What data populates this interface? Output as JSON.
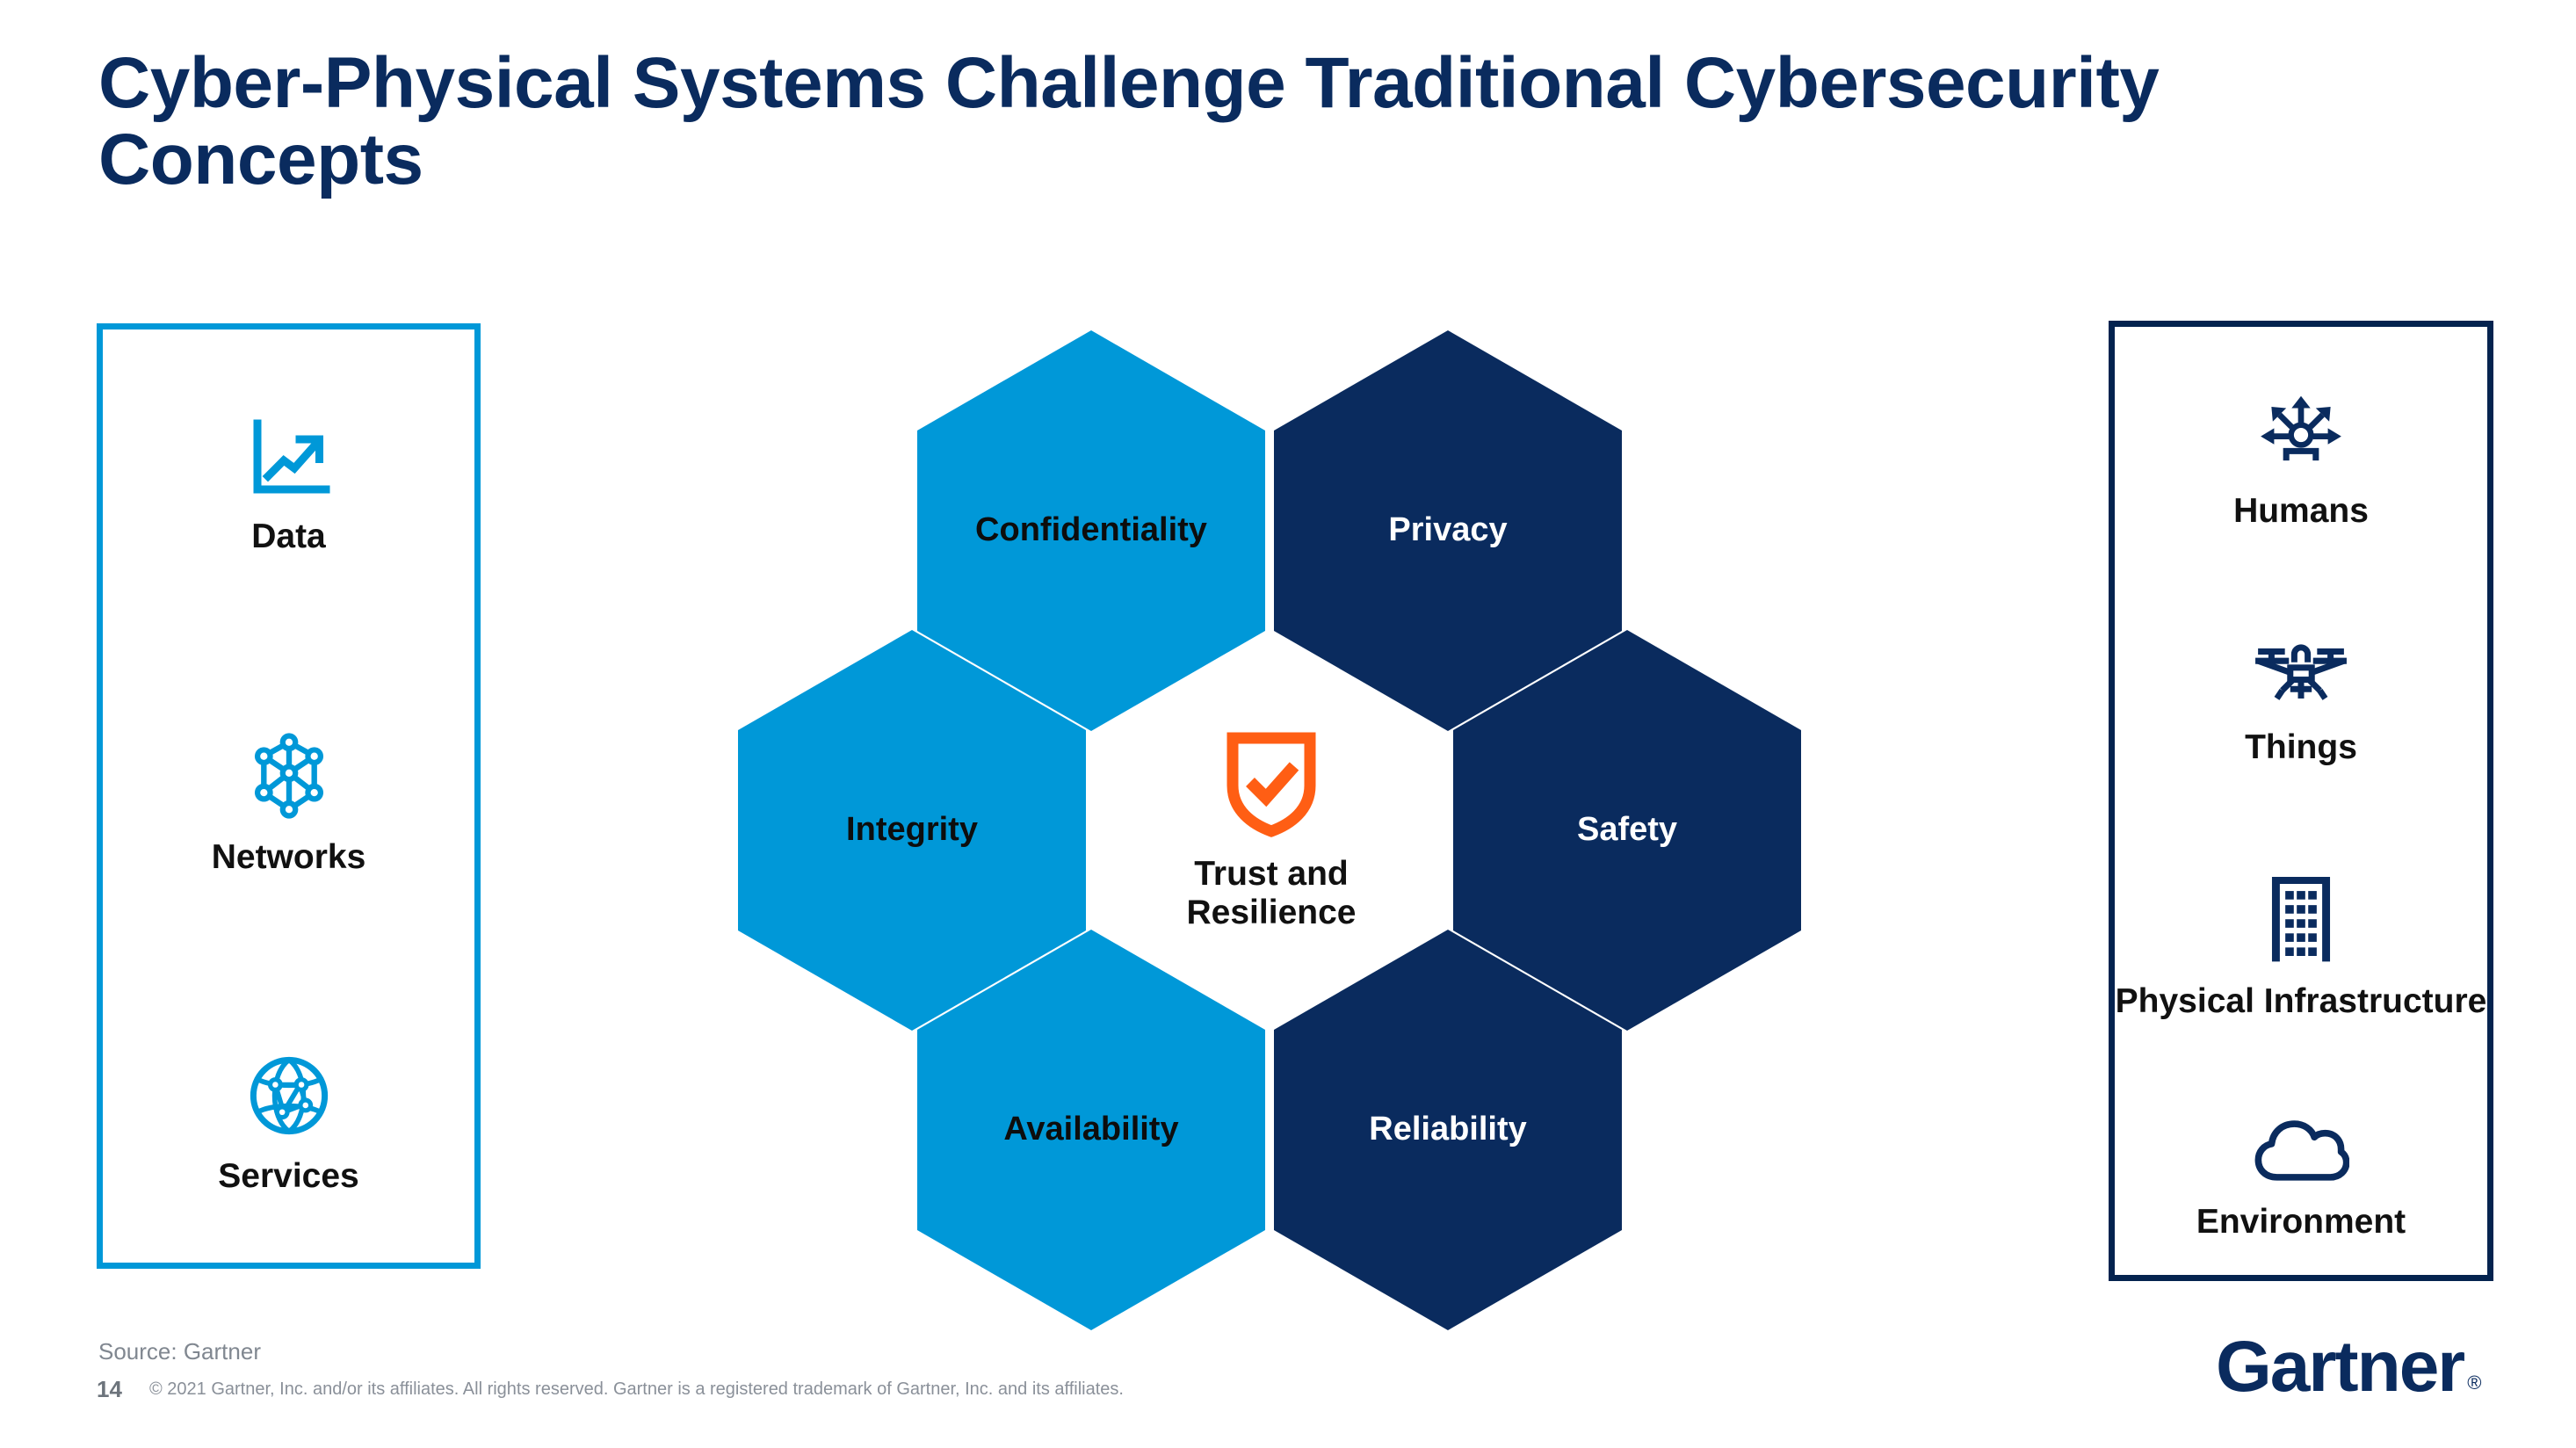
{
  "slide": {
    "title": "Cyber-Physical Systems Challenge Traditional Cybersecurity Concepts",
    "page_number": "14",
    "source_note": "Source: Gartner",
    "copyright_note": "© 2021 Gartner, Inc. and/or its affiliates. All rights reserved. Gartner is a registered trademark of Gartner, Inc. and its affiliates.",
    "logo": {
      "wordmark": "Gartner",
      "registered_mark": "®"
    }
  },
  "colors": {
    "title_navy": "#0A2B5E",
    "light_blue": "#0098D8",
    "dark_navy": "#0A2B5E",
    "panel_border_left": "#0098D8",
    "panel_border_right": "#04234F",
    "shield_orange": "#FF5E14",
    "label_black": "#111111",
    "footer_gray": "#808790"
  },
  "left_panel": {
    "border_color": "#0098D8",
    "items": [
      {
        "label": "Data",
        "icon": "line-chart-growth-icon"
      },
      {
        "label": "Networks",
        "icon": "network-nodes-icon"
      },
      {
        "label": "Services",
        "icon": "global-network-sphere-icon"
      }
    ]
  },
  "right_panel": {
    "border_color": "#04234F",
    "items": [
      {
        "label": "Humans",
        "icon": "person-radiating-arrows-icon"
      },
      {
        "label": "Things",
        "icon": "drone-icon"
      },
      {
        "label": "Physical Infrastructure",
        "icon": "building-icon"
      },
      {
        "label": "Environment",
        "icon": "cloud-icon"
      }
    ]
  },
  "hex_cluster": {
    "center": {
      "label": "Trust and\nResilience",
      "icon": "shield-check-icon",
      "icon_color": "#FF5E14"
    },
    "hexagons": [
      {
        "key": "confidentiality",
        "label": "Confidentiality",
        "fill": "#0098D8",
        "text_color": "#0d0d0d",
        "position": "top-left"
      },
      {
        "key": "privacy",
        "label": "Privacy",
        "fill": "#0A2B5E",
        "text_color": "#ffffff",
        "position": "top-right"
      },
      {
        "key": "integrity",
        "label": "Integrity",
        "fill": "#0098D8",
        "text_color": "#0d0d0d",
        "position": "middle-left"
      },
      {
        "key": "safety",
        "label": "Safety",
        "fill": "#0A2B5E",
        "text_color": "#ffffff",
        "position": "middle-right"
      },
      {
        "key": "availability",
        "label": "Availability",
        "fill": "#0098D8",
        "text_color": "#0d0d0d",
        "position": "bottom-left"
      },
      {
        "key": "reliability",
        "label": "Reliability",
        "fill": "#0A2B5E",
        "text_color": "#ffffff",
        "position": "bottom-right"
      }
    ]
  }
}
